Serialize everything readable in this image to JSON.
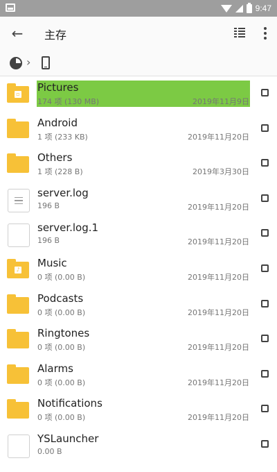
{
  "status_bar": {
    "time": "9:47"
  },
  "toolbar": {
    "title": "主存"
  },
  "files": [
    {
      "name": "Pictures",
      "meta": "174 项 (130 MB)",
      "date": "2019年11月9日",
      "type": "folder",
      "badge": "▫",
      "selected": true
    },
    {
      "name": "Android",
      "meta": "1 项 (233 KB)",
      "date": "2019年11月20日",
      "type": "folder",
      "badge": "",
      "selected": false
    },
    {
      "name": "Others",
      "meta": "1 项 (228 B)",
      "date": "2019年3月30日",
      "type": "folder",
      "badge": "",
      "selected": false
    },
    {
      "name": "server.log",
      "meta": "196 B",
      "date": "2019年11月20日",
      "type": "text-file",
      "badge": "",
      "selected": false
    },
    {
      "name": "server.log.1",
      "meta": "196 B",
      "date": "2019年11月20日",
      "type": "file",
      "badge": "",
      "selected": false
    },
    {
      "name": "Music",
      "meta": "0 项 (0.00 B)",
      "date": "2019年11月20日",
      "type": "folder",
      "badge": "♪",
      "selected": false
    },
    {
      "name": "Podcasts",
      "meta": "0 项 (0.00 B)",
      "date": "2019年11月20日",
      "type": "folder",
      "badge": "",
      "selected": false
    },
    {
      "name": "Ringtones",
      "meta": "0 项 (0.00 B)",
      "date": "2019年11月20日",
      "type": "folder",
      "badge": "",
      "selected": false
    },
    {
      "name": "Alarms",
      "meta": "0 项 (0.00 B)",
      "date": "2019年11月20日",
      "type": "folder",
      "badge": "",
      "selected": false
    },
    {
      "name": "Notifications",
      "meta": "0 项 (0.00 B)",
      "date": "2019年11月20日",
      "type": "folder",
      "badge": "",
      "selected": false
    },
    {
      "name": "YSLauncher",
      "meta": "0.00 B",
      "date": "",
      "type": "file",
      "badge": "",
      "selected": false
    }
  ],
  "colors": {
    "folder": "#f7c137",
    "selection": "#7cca44",
    "status_bar": "#9e9e9e"
  },
  "icons": {
    "back": "arrow-left-icon",
    "view": "list-view-icon",
    "more": "more-vert-icon",
    "storage": "pie-chart-icon",
    "device": "phone-icon"
  }
}
